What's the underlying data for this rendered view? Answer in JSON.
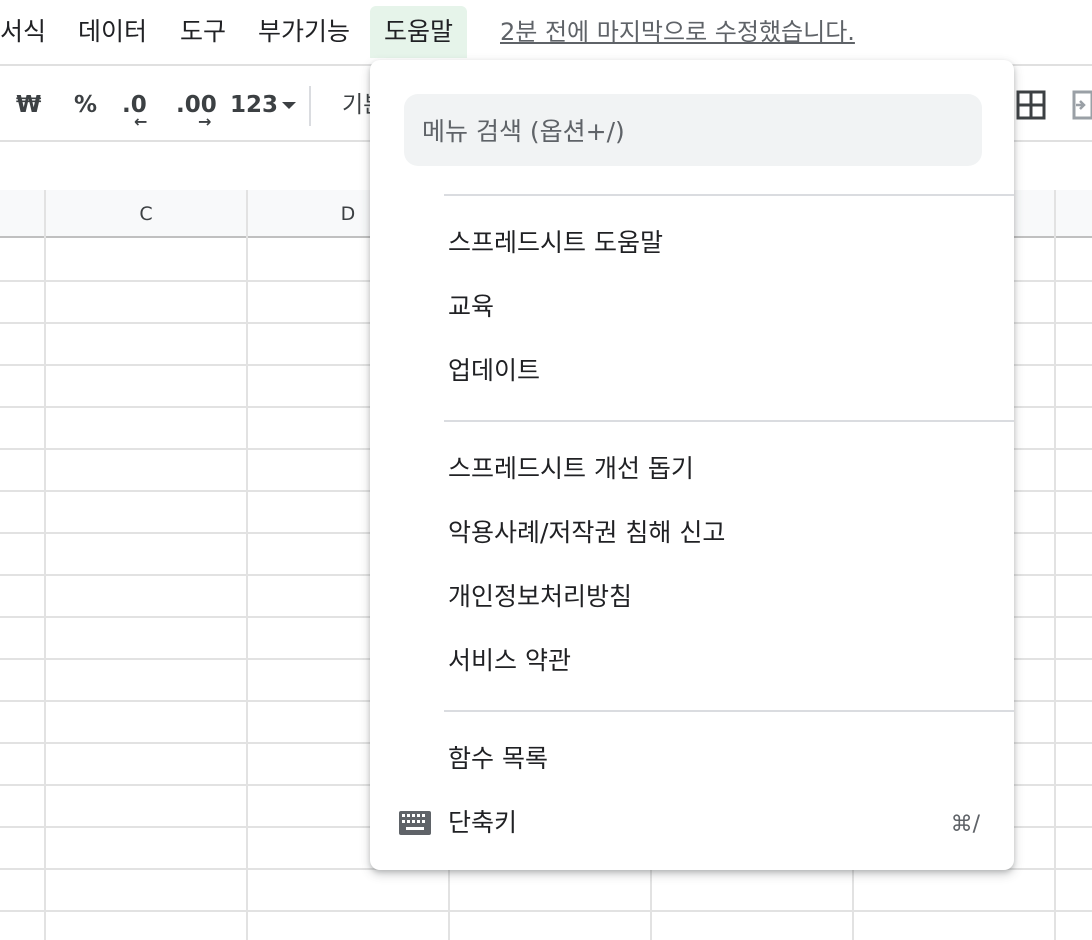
{
  "menubar": {
    "items": [
      "서식",
      "데이터",
      "도구",
      "부가기능",
      "도움말"
    ],
    "last_edit": "2분 전에 마지막으로 수정했습니다."
  },
  "toolbar": {
    "currency": "₩",
    "percent": "%",
    "decrease_decimal": ".0",
    "increase_decimal": ".00",
    "more_formats": "123",
    "font_truncated": "기본"
  },
  "grid": {
    "columns": [
      "C",
      "D"
    ]
  },
  "help_menu": {
    "search_placeholder": "메뉴 검색 (옵션+/)",
    "group1": [
      "스프레드시트 도움말",
      "교육",
      "업데이트"
    ],
    "group2": [
      "스프레드시트 개선 돕기",
      "악용사례/저작권 침해 신고",
      "개인정보처리방침",
      "서비스 약관"
    ],
    "group3": [
      "함수 목록",
      "단축키"
    ],
    "shortcut_key": "⌘/"
  }
}
